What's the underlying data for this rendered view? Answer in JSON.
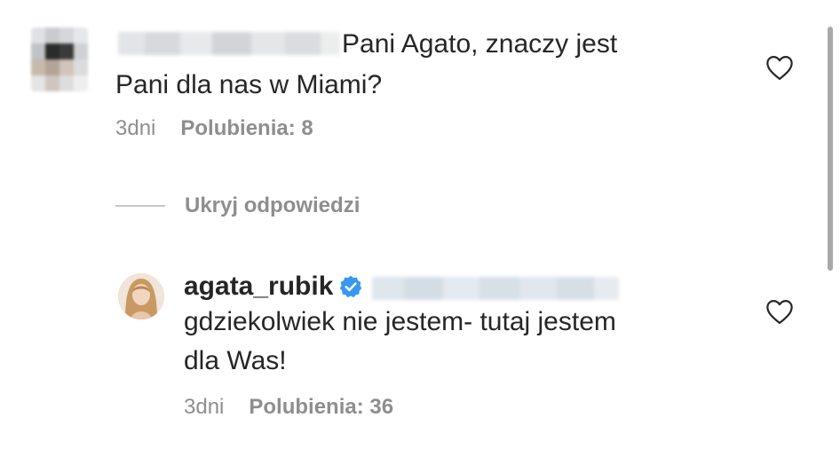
{
  "comment1": {
    "text_line1": "Pani Agato, znaczy jest",
    "text_line2": "Pani dla nas w Miami?",
    "time": "3dni",
    "likes": "Polubienia: 8"
  },
  "hide_replies": {
    "label": "Ukryj odpowiedzi"
  },
  "reply1": {
    "username": "agata_rubik",
    "text_line1": "gdziekolwiek nie jestem- tutaj jestem",
    "text_line2": "dla Was!",
    "time": "3dni",
    "likes": "Polubienia: 36"
  },
  "colors": {
    "text": "#262626",
    "muted": "#8e8e8e",
    "verified": "#3897f0",
    "divider": "#c7c7c7"
  },
  "icons": {
    "like": "heart-icon",
    "verified": "verified-badge-icon"
  }
}
